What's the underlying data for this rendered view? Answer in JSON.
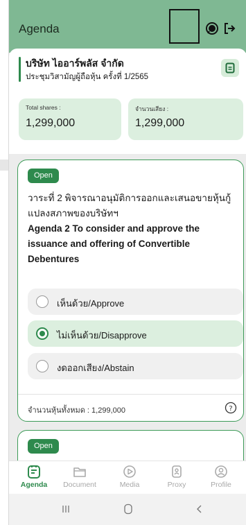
{
  "appbar": {
    "title": "Agenda",
    "icons": [
      "chat-icon",
      "logout-icon"
    ]
  },
  "company": {
    "name": "บริษัท ไออาร์พลัส จำกัด",
    "meeting": "ประชุมวิสามัญผู้ถือหุ้น ครั้งที่ 1/2565",
    "stats": [
      {
        "label": "Total shares :",
        "value": "1,299,000"
      },
      {
        "label": "จำนวนเสียง :",
        "value": "1,299,000"
      }
    ]
  },
  "agenda": {
    "status": "Open",
    "title_th": "วาระที่ 2 พิจารณาอนุมัติการออกและเสนอขายหุ้นกู้แปลงสภาพของบริษัทฯ",
    "title_en": "Agenda 2 To consider and approve the issuance and offering of Convertible Debentures",
    "options": [
      {
        "label": "เห็นด้วย/Approve",
        "selected": false
      },
      {
        "label": "ไม่เห็นด้วย/Disapprove",
        "selected": true
      },
      {
        "label": "งดออกเสียง/Abstain",
        "selected": false
      }
    ],
    "total": "จำนวนหุ้นทั้งหมด : 1,299,000"
  },
  "agenda_next": {
    "status": "Open"
  },
  "nav": {
    "items": [
      {
        "label": "Agenda",
        "icon": "agenda-icon",
        "active": true
      },
      {
        "label": "Document",
        "icon": "folder-icon",
        "active": false
      },
      {
        "label": "Media",
        "icon": "play-icon",
        "active": false
      },
      {
        "label": "Proxy",
        "icon": "proxy-icon",
        "active": false
      },
      {
        "label": "Profile",
        "icon": "profile-icon",
        "active": false
      }
    ]
  },
  "colors": {
    "primary": "#2e8a4d",
    "appbar": "#7fb893",
    "light_green": "#dcefdf"
  }
}
